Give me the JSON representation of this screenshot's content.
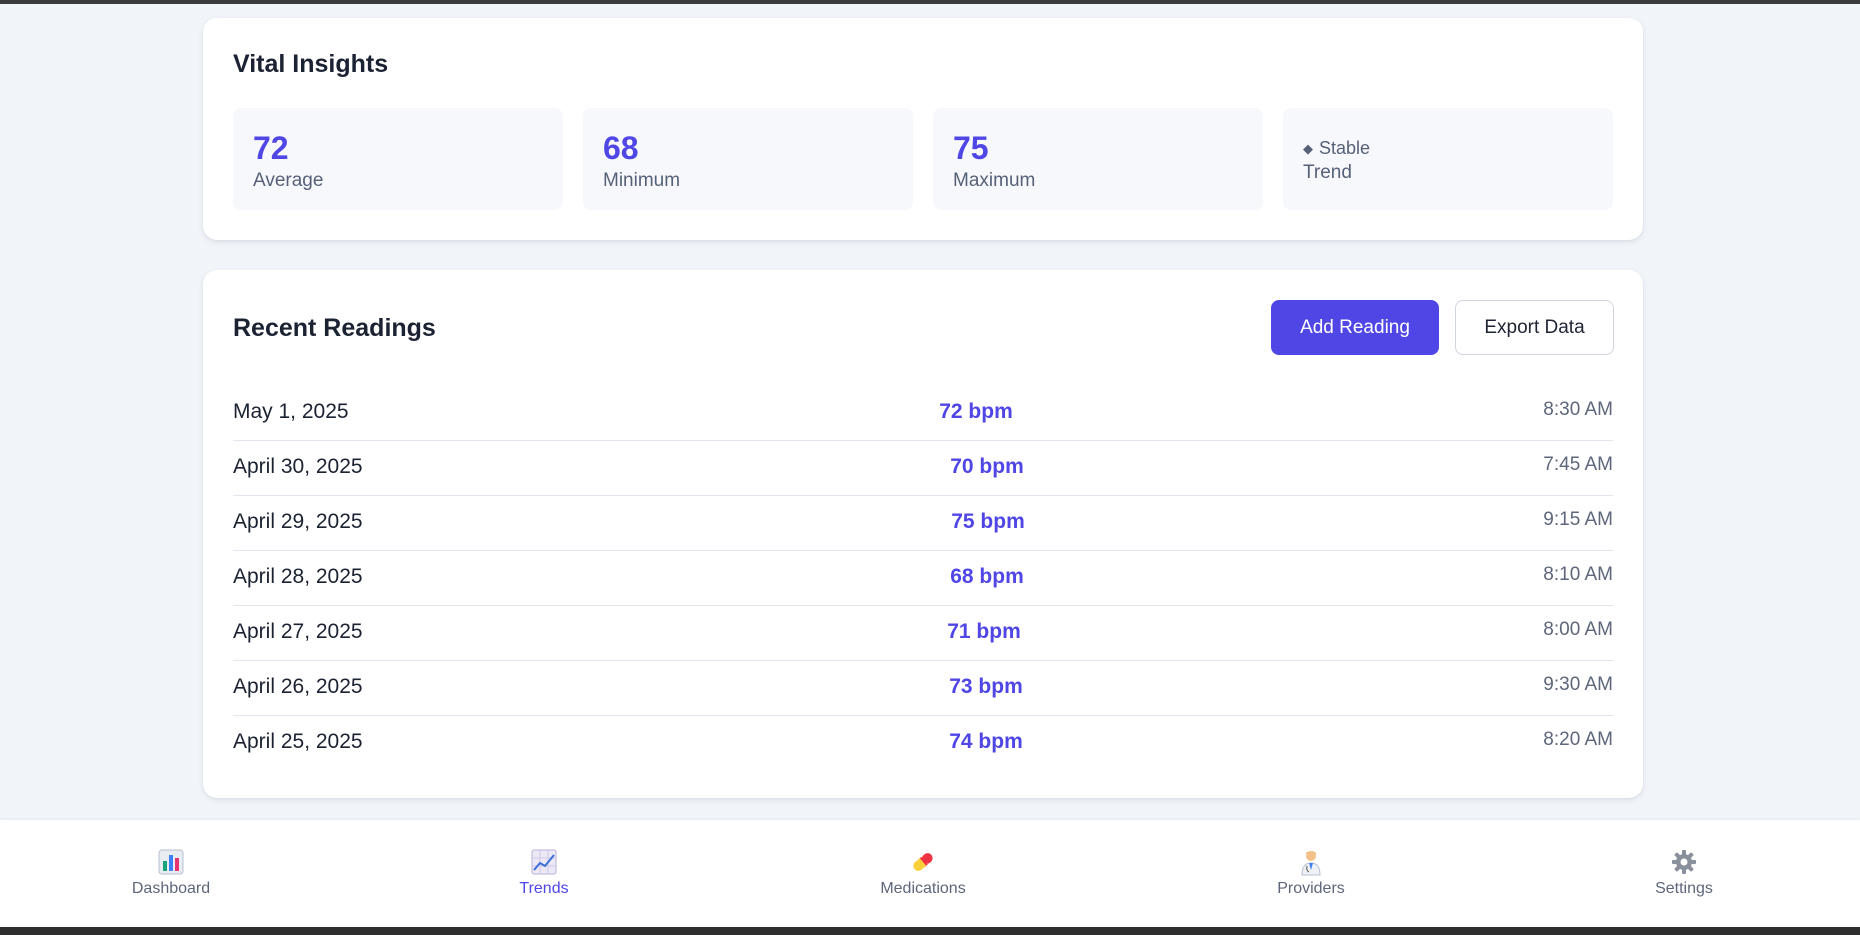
{
  "insights": {
    "title": "Vital Insights",
    "stats": [
      {
        "value": "72",
        "label": "Average"
      },
      {
        "value": "68",
        "label": "Minimum"
      },
      {
        "value": "75",
        "label": "Maximum"
      }
    ],
    "trend": {
      "indicator": "Stable",
      "icon": "diamond-icon",
      "label": "Trend"
    }
  },
  "readings": {
    "title": "Recent Readings",
    "add_label": "Add Reading",
    "export_label": "Export Data",
    "rows": [
      {
        "date": "May 1, 2025",
        "value": "72 bpm",
        "time": "8:30 AM"
      },
      {
        "date": "April 30, 2025",
        "value": "70 bpm",
        "time": "7:45 AM"
      },
      {
        "date": "April 29, 2025",
        "value": "75 bpm",
        "time": "9:15 AM"
      },
      {
        "date": "April 28, 2025",
        "value": "68 bpm",
        "time": "8:10 AM"
      },
      {
        "date": "April 27, 2025",
        "value": "71 bpm",
        "time": "8:00 AM"
      },
      {
        "date": "April 26, 2025",
        "value": "73 bpm",
        "time": "9:30 AM"
      },
      {
        "date": "April 25, 2025",
        "value": "74 bpm",
        "time": "8:20 AM"
      }
    ]
  },
  "nav": {
    "items": [
      {
        "label": "Dashboard",
        "icon": "bar-chart-icon",
        "active": false
      },
      {
        "label": "Trends",
        "icon": "line-chart-icon",
        "active": true
      },
      {
        "label": "Medications",
        "icon": "pill-icon",
        "active": false
      },
      {
        "label": "Providers",
        "icon": "doctor-icon",
        "active": false
      },
      {
        "label": "Settings",
        "icon": "gear-icon",
        "active": false
      }
    ]
  },
  "colors": {
    "accent": "#4f46e5",
    "background": "#f1f4f9",
    "card": "#ffffff",
    "muted_text": "#5d667a"
  }
}
